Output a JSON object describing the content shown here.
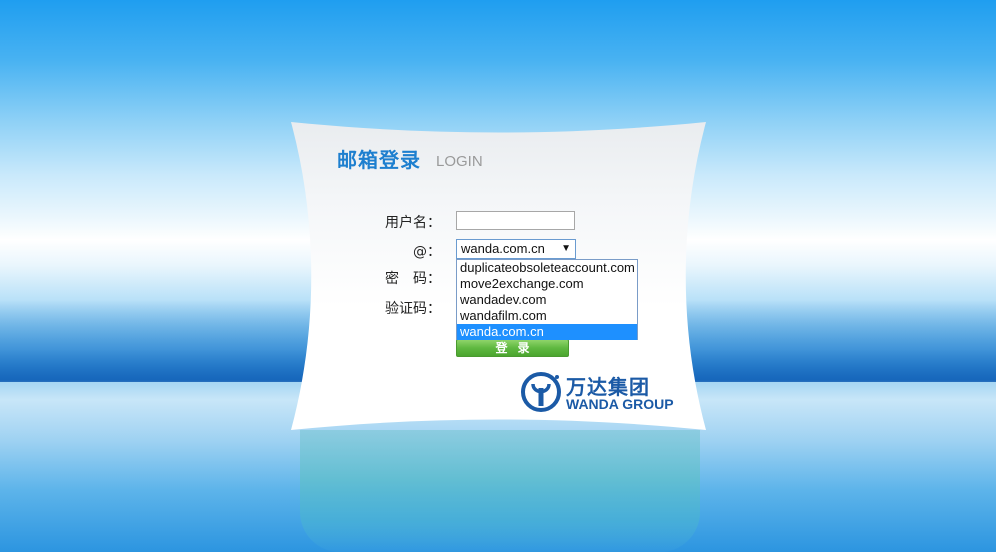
{
  "header": {
    "title_cn": "邮箱登录",
    "title_en": "LOGIN"
  },
  "form": {
    "username_label": "用户名：",
    "domain_label": "@：",
    "password_label": "密　码：",
    "captcha_label": "验证码：",
    "username_value": "",
    "domain_selected": "wanda.com.cn",
    "domain_options": [
      "duplicateobsoleteaccount.com",
      "move2exchange.com",
      "wandadev.com",
      "wandafilm.com",
      "wanda.com.cn"
    ],
    "login_button": "登录"
  },
  "logo": {
    "name_cn": "万达集团",
    "name_en": "WANDA GROUP"
  },
  "colors": {
    "accent": "#1d7fcf",
    "brand": "#1b5aa6",
    "button": "#5fb840",
    "selection": "#1e90ff"
  }
}
